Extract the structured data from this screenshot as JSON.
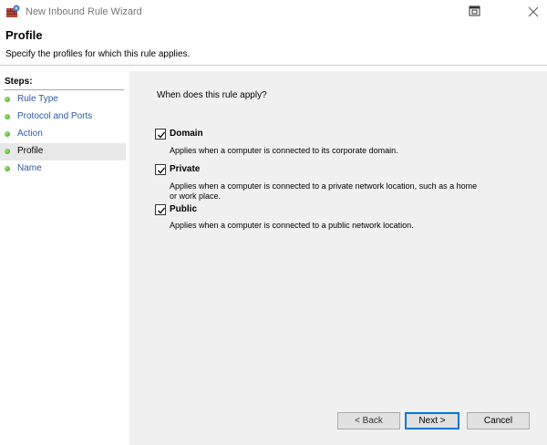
{
  "window": {
    "title": "New Inbound Rule Wizard",
    "icons": [
      "firewall-app-icon",
      "help-icon",
      "close-icon"
    ]
  },
  "header": {
    "title": "Profile",
    "subtitle": "Specify the profiles for which this rule applies."
  },
  "sidebar": {
    "steps_label": "Steps:",
    "items": [
      {
        "label": "Rule Type"
      },
      {
        "label": "Protocol and Ports"
      },
      {
        "label": "Action"
      },
      {
        "label": "Profile",
        "current": true
      },
      {
        "label": "Name"
      }
    ]
  },
  "main": {
    "question": "When does this rule apply?",
    "profiles": [
      {
        "name": "Domain",
        "checked": true,
        "description": "Applies when a computer is connected to its corporate domain."
      },
      {
        "name": "Private",
        "checked": true,
        "description": "Applies when a computer is connected to a private network location, such as a home or work place."
      },
      {
        "name": "Public",
        "checked": true,
        "description": "Applies when a computer is connected to a public network location."
      }
    ]
  },
  "buttons": {
    "back": "< Back",
    "next": "Next >",
    "cancel": "Cancel"
  },
  "colors": {
    "link": "#2b5aa6",
    "step_dot": "#3aa51d",
    "default_button_border": "#0078d7",
    "content_bg": "#f0f0f0"
  }
}
